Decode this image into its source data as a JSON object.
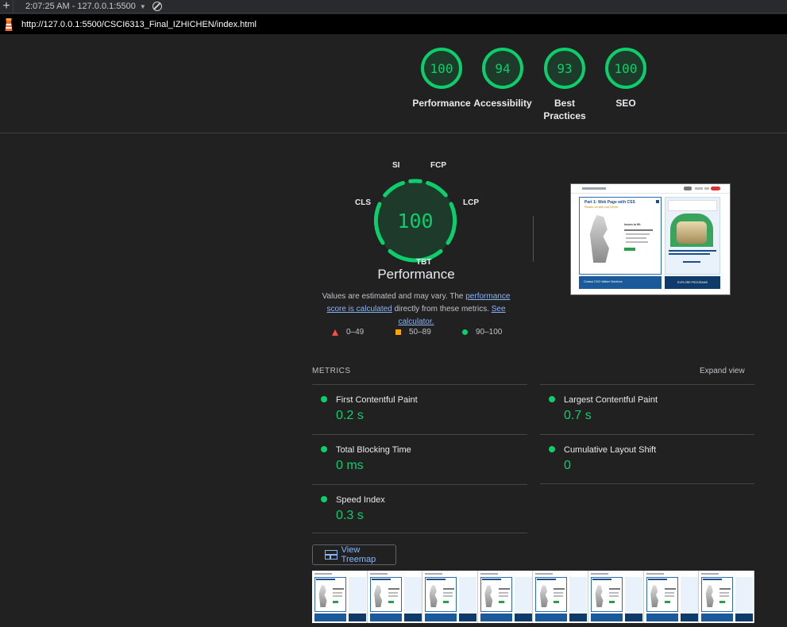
{
  "browser": {
    "session_label": "2:07:25 AM - 127.0.0.1:5500",
    "url": "http://127.0.0.1:5500/CSCI6313_Final_IZHICHEN/index.html"
  },
  "categories": [
    {
      "name": "Performance",
      "score": "100"
    },
    {
      "name": "Accessibility",
      "score": "94"
    },
    {
      "name": "Best Practices",
      "score": "93"
    },
    {
      "name": "SEO",
      "score": "100"
    }
  ],
  "performance": {
    "score": "100",
    "title": "Performance",
    "tags": {
      "si": "SI",
      "fcp": "FCP",
      "lcp": "LCP",
      "tbt": "TBT",
      "cls": "CLS"
    },
    "note_prefix": "Values are estimated and may vary. The ",
    "note_link1": "performance score is calculated",
    "note_middle": " directly from these metrics. ",
    "note_link2": "See calculator."
  },
  "legend": {
    "fail": "0–49",
    "average": "50–89",
    "pass": "90–100"
  },
  "metrics": {
    "heading": "METRICS",
    "expand_label": "Expand view",
    "items": [
      {
        "name": "First Contentful Paint",
        "value": "0.2 s"
      },
      {
        "name": "Largest Contentful Paint",
        "value": "0.7 s"
      },
      {
        "name": "Total Blocking Time",
        "value": "0 ms"
      },
      {
        "name": "Cumulative Layout Shift",
        "value": "0"
      },
      {
        "name": "Speed Index",
        "value": "0.3 s"
      }
    ]
  },
  "treemap_label": "View Treemap",
  "colors": {
    "pass": "#0cce6b",
    "average": "#ffa400",
    "fail": "#ff4e42",
    "link": "#8ab4f8"
  },
  "screenshot_preview": {
    "heading": "Part 1: Web Page with CSS",
    "subheading": "Please run with Live Server",
    "card_title": "Issues to fill:",
    "bottom_left": "Contact CSCI Walker Solutions",
    "bottom_right": "EXPLORE PROGRAMS"
  }
}
